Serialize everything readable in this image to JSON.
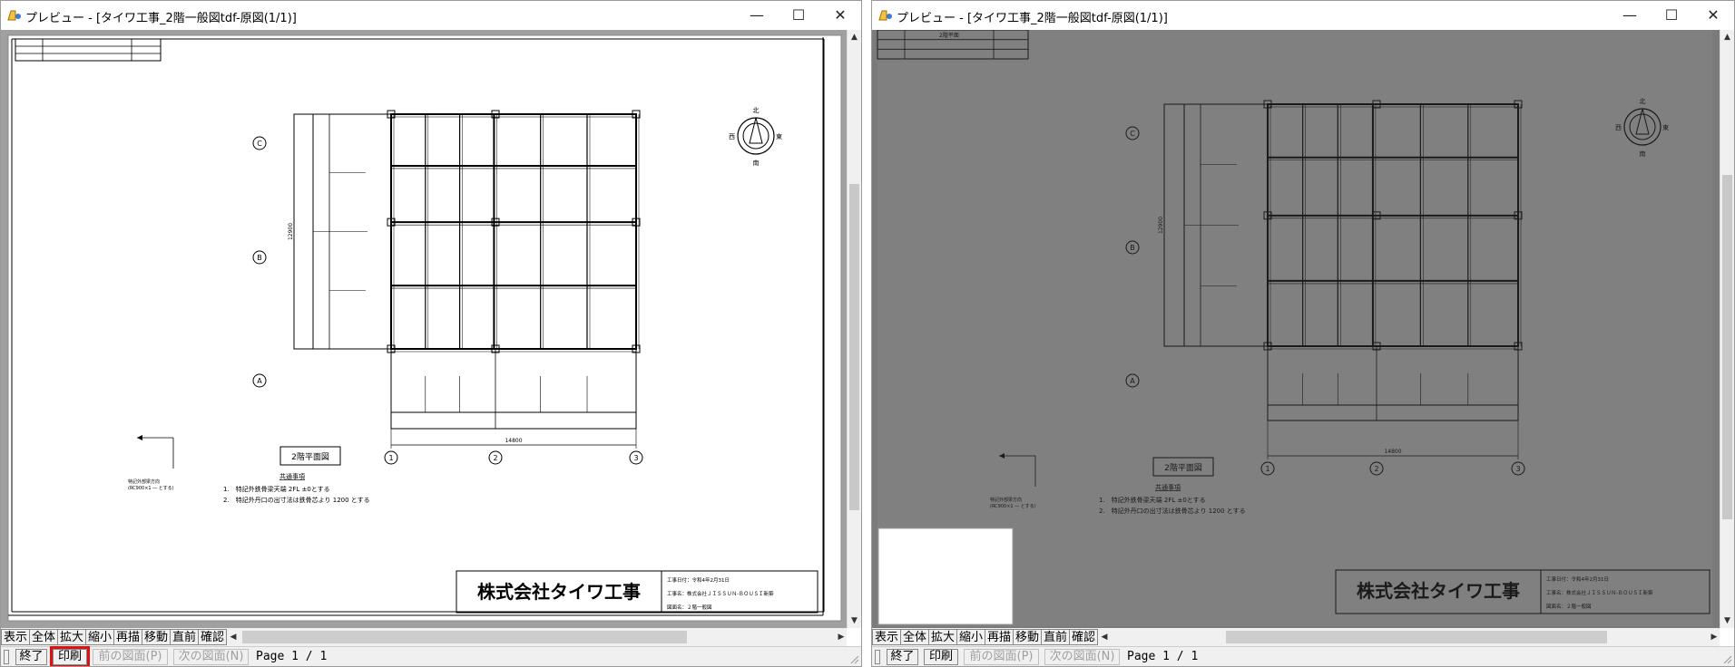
{
  "windows": [
    {
      "title": "プレビュー - [タイワ工事_2階一般図tdf-原図(1/1)]",
      "preview_mode": "original"
    },
    {
      "title": "プレビュー - [タイワ工事_2階一般図tdf-原図(1/1)]",
      "preview_mode": "grayscale"
    }
  ],
  "caption_buttons": {
    "minimize": "—",
    "maximize": "☐",
    "close": "✕"
  },
  "toolbar": {
    "buttons": [
      "表示",
      "全体",
      "拡大",
      "縮小",
      "再描",
      "移動",
      "直前",
      "確認"
    ]
  },
  "bottombar": {
    "exit_label": "終了",
    "print_label": "印刷",
    "prev_label": "前の図面(P)",
    "next_label": "次の図面(N)",
    "page_label": "Page 1 / 1"
  },
  "drawing": {
    "grid_row_labels": [
      "C",
      "B",
      "A"
    ],
    "grid_col_labels": [
      "1",
      "2",
      "3"
    ],
    "dim_horizontal": "14800",
    "dim_vertical": "12900",
    "plan_title": "2階平面図",
    "compass": {
      "north": "北",
      "south": "南",
      "east": "東",
      "west": "西"
    },
    "notes_title": "共通事項",
    "notes": [
      "1.　特記外鉄骨梁天端 2FL ±0とする",
      "2.　特記外丹口の出寸法は鉄骨芯より 1200 とする"
    ],
    "arrow_note_line1": "特記外部梁方向",
    "arrow_note_line2": "(RC900×1 ― とする)",
    "company": "株式会社タイワ工事",
    "title_block": [
      "工事日付：令和4年2月31日",
      "工事名：株式会社ＪＩＳＳＵＮ-ＢＯＵＳＩ新築",
      "図面名：２階一般図"
    ],
    "header_cell_text": "2階平面"
  },
  "colors": {
    "highlight": "#e01010",
    "paper_gray": "#808080"
  }
}
